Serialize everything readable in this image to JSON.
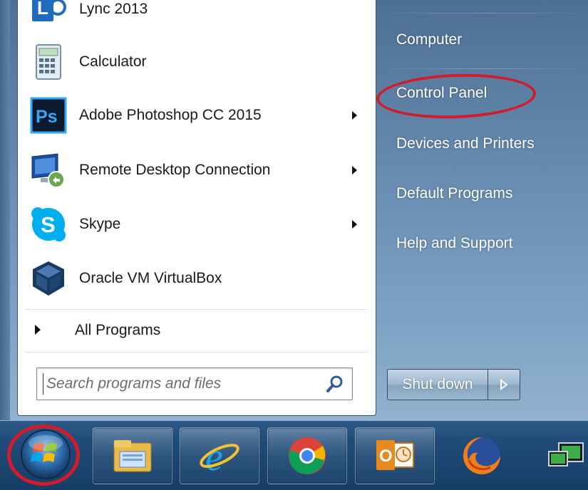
{
  "start_menu": {
    "programs": [
      {
        "label": "Lync 2013",
        "icon": "lync-icon",
        "has_submenu": false
      },
      {
        "label": "Calculator",
        "icon": "calculator-icon",
        "has_submenu": false
      },
      {
        "label": "Adobe Photoshop CC 2015",
        "icon": "photoshop-icon",
        "has_submenu": true
      },
      {
        "label": "Remote Desktop Connection",
        "icon": "remote-desktop-icon",
        "has_submenu": true
      },
      {
        "label": "Skype",
        "icon": "skype-icon",
        "has_submenu": true
      },
      {
        "label": "Oracle VM VirtualBox",
        "icon": "virtualbox-icon",
        "has_submenu": false
      }
    ],
    "all_programs_label": "All Programs",
    "search": {
      "placeholder": "Search programs and files"
    },
    "right_links": [
      "Computer",
      "Control Panel",
      "Devices and Printers",
      "Default Programs",
      "Help and Support"
    ],
    "highlighted_link": "Control Panel",
    "shutdown_label": "Shut down",
    "ps_icon_text": "Ps",
    "skype_icon_text": "S"
  },
  "taskbar": {
    "items": [
      "start-orb",
      "file-explorer-icon",
      "internet-explorer-icon",
      "chrome-icon",
      "outlook-icon",
      "firefox-icon",
      "network-icon"
    ]
  },
  "colors": {
    "annotation_red": "#d21c2b",
    "taskbar": "#1f4b78",
    "menu_right_pane": "#6a8fb3"
  }
}
